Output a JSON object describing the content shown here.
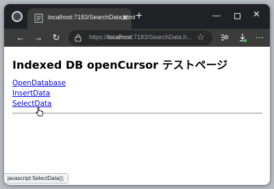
{
  "tab": {
    "title": "localhost:7183/SearchData.html",
    "close_glyph": "✕",
    "new_tab_glyph": "+"
  },
  "window_controls": {
    "minimize": "—",
    "close": "✕"
  },
  "toolbar": {
    "back": "←",
    "forward": "→",
    "reload": "↻",
    "more": "⋯",
    "url_scheme": "https://",
    "url_host": "localhost",
    "url_rest": ":7183/SearchData.h..."
  },
  "page": {
    "heading": "Indexed DB openCursor テストページ",
    "links": [
      {
        "label": "OpenDatabase"
      },
      {
        "label": "InsertData"
      },
      {
        "label": "SelectData"
      }
    ]
  },
  "status": {
    "text": "javascript:SelectData();"
  },
  "colors": {
    "link": "#0000ee",
    "tab_bg": "#3b3b3b",
    "window_bg": "#202124"
  },
  "icons": [
    "browser-app-icon",
    "page-favicon",
    "lock-icon",
    "star-icon",
    "collections-icon",
    "downloads-icon",
    "hand-cursor-icon"
  ]
}
